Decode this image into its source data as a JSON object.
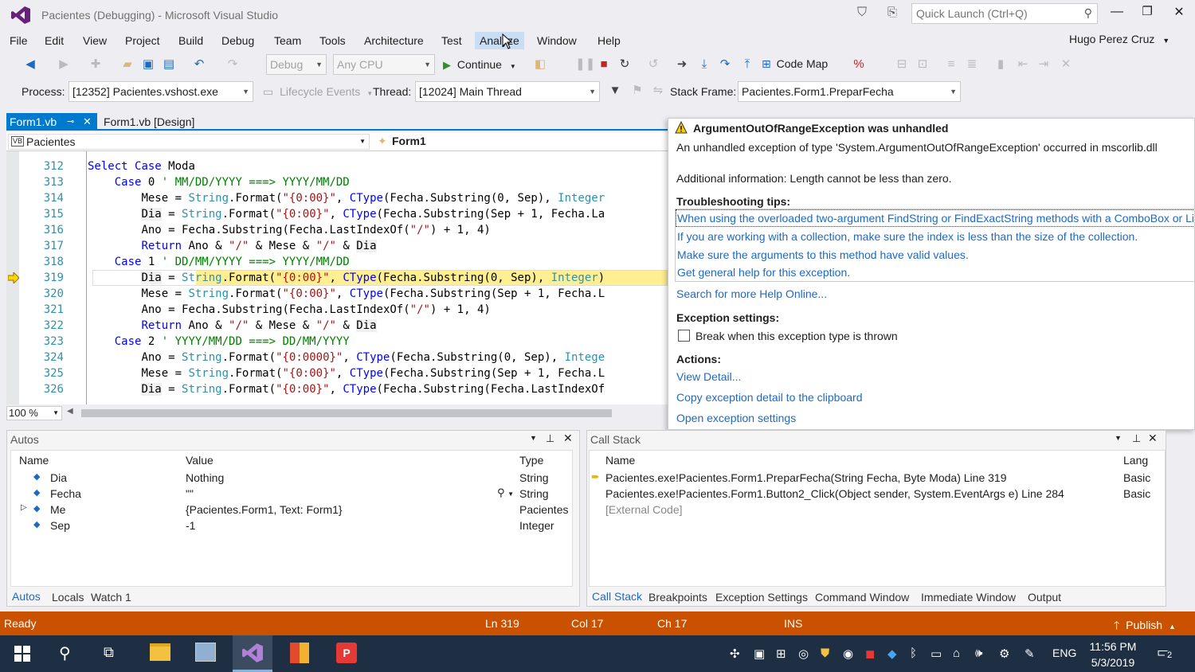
{
  "window": {
    "title": "Pacientes (Debugging) - Microsoft Visual Studio",
    "quick_launch_placeholder": "Quick Launch (Ctrl+Q)",
    "user": "Hugo Perez Cruz"
  },
  "menu": [
    "File",
    "Edit",
    "View",
    "Project",
    "Build",
    "Debug",
    "Team",
    "Tools",
    "Architecture",
    "Test",
    "Analyze",
    "Window",
    "Help"
  ],
  "toolbar": {
    "config": "Debug",
    "platform": "Any CPU",
    "continue_label": "Continue",
    "code_map_label": "Code Map"
  },
  "debug_location": {
    "process_label": "Process:",
    "process_value": "[12352] Pacientes.vshost.exe",
    "lifecycle_label": "Lifecycle Events",
    "thread_label": "Thread:",
    "thread_value": "[12024] Main Thread",
    "stack_frame_label": "Stack Frame:",
    "stack_frame_value": "Pacientes.Form1.PreparFecha"
  },
  "tabs": [
    {
      "label": "Form1.vb",
      "active": true
    },
    {
      "label": "Form1.vb [Design]",
      "active": false
    }
  ],
  "nav": {
    "project": "Pacientes",
    "member": "Form1"
  },
  "editor": {
    "zoom": "100 %",
    "current_line": 319,
    "lines": [
      {
        "n": "312",
        "code": "        Select Case Moda"
      },
      {
        "n": "313",
        "code": "            Case 0 ' MM/DD/YYYY ===> YYYY/MM/DD"
      },
      {
        "n": "314",
        "code": "                Mese = String.Format(\"{0:00}\", CType(Fecha.Substring(0, Sep), Integer"
      },
      {
        "n": "315",
        "code": "                Dia = String.Format(\"{0:00}\", CType(Fecha.Substring(Sep + 1, Fecha.La"
      },
      {
        "n": "316",
        "code": "                Ano = Fecha.Substring(Fecha.LastIndexOf(\"/\") + 1, 4)"
      },
      {
        "n": "317",
        "code": "                Return Ano & \"/\" & Mese & \"/\" & Dia"
      },
      {
        "n": "318",
        "code": "            Case 1 ' DD/MM/YYYY ===> YYYY/MM/DD"
      },
      {
        "n": "319",
        "code": "                Dia = String.Format(\"{0:00}\", CType(Fecha.Substring(0, Sep), Integer)"
      },
      {
        "n": "320",
        "code": "                Mese = String.Format(\"{0:00}\", CType(Fecha.Substring(Sep + 1, Fecha.L"
      },
      {
        "n": "321",
        "code": "                Ano = Fecha.Substring(Fecha.LastIndexOf(\"/\") + 1, 4)"
      },
      {
        "n": "322",
        "code": "                Return Ano & \"/\" & Mese & \"/\" & Dia"
      },
      {
        "n": "323",
        "code": "            Case 2 ' YYYY/MM/DD ===> DD/MM/YYYY"
      },
      {
        "n": "324",
        "code": "                Ano = String.Format(\"{0:0000}\", CType(Fecha.Substring(0, Sep), Intege"
      },
      {
        "n": "325",
        "code": "                Mese = String.Format(\"{0:00}\", CType(Fecha.Substring(Sep + 1, Fecha.L"
      },
      {
        "n": "326",
        "code": "                Dia = String.Format(\"{0:00}\", CType(Fecha.Substring(Fecha.LastIndexOf"
      }
    ]
  },
  "exception": {
    "title": "ArgumentOutOfRangeException was unhandled",
    "message": "An unhandled exception of type 'System.ArgumentOutOfRangeException' occurred in mscorlib.dll",
    "additional": "Additional information: Length cannot be less than zero.",
    "tips_heading": "Troubleshooting tips:",
    "tips": [
      "When using the overloaded two-argument FindString or FindExactString methods with a ComboBox or Li",
      "If you are working with a collection, make sure the index is less than the size of the collection.",
      "Make sure the arguments to this method have valid values.",
      "Get general help for this exception."
    ],
    "search_online": "Search for more Help Online...",
    "settings_heading": "Exception settings:",
    "break_checkbox": "Break when this exception type is thrown",
    "actions_heading": "Actions:",
    "actions": [
      "View Detail...",
      "Copy exception detail to the clipboard",
      "Open exception settings"
    ]
  },
  "autos": {
    "title": "Autos",
    "headers": [
      "Name",
      "Value",
      "Type"
    ],
    "rows": [
      {
        "name": "Dia",
        "value": "Nothing",
        "type": "String"
      },
      {
        "name": "Fecha",
        "value": "\"\"",
        "type": "String"
      },
      {
        "name": "Me",
        "value": "{Pacientes.Form1, Text: Form1}",
        "type": "Pacientes"
      },
      {
        "name": "Sep",
        "value": "-1",
        "type": "Integer"
      }
    ],
    "tabs": [
      "Autos",
      "Locals",
      "Watch 1"
    ]
  },
  "callstack": {
    "title": "Call Stack",
    "headers": [
      "Name",
      "Lang"
    ],
    "rows": [
      {
        "name": "Pacientes.exe!Pacientes.Form1.PreparFecha(String Fecha, Byte Moda) Line 319",
        "lang": "Basic"
      },
      {
        "name": "Pacientes.exe!Pacientes.Form1.Button2_Click(Object sender, System.EventArgs e) Line 284",
        "lang": "Basic"
      },
      {
        "name": "[External Code]",
        "lang": ""
      }
    ],
    "tabs": [
      "Call Stack",
      "Breakpoints",
      "Exception Settings",
      "Command Window",
      "Immediate Window",
      "Output"
    ]
  },
  "status": {
    "ready": "Ready",
    "ln": "Ln 319",
    "col": "Col 17",
    "ch": "Ch 17",
    "ins": "INS",
    "publish": "Publish"
  },
  "taskbar": {
    "lang": "ENG",
    "time": "11:56 PM",
    "date": "5/3/2019",
    "notif_count": "2"
  },
  "colors": {
    "accent": "#007acc",
    "status_bar": "#ca5100",
    "current_line": "#ffef91",
    "link": "#1e6ac2",
    "taskbar": "#1f2f43"
  }
}
